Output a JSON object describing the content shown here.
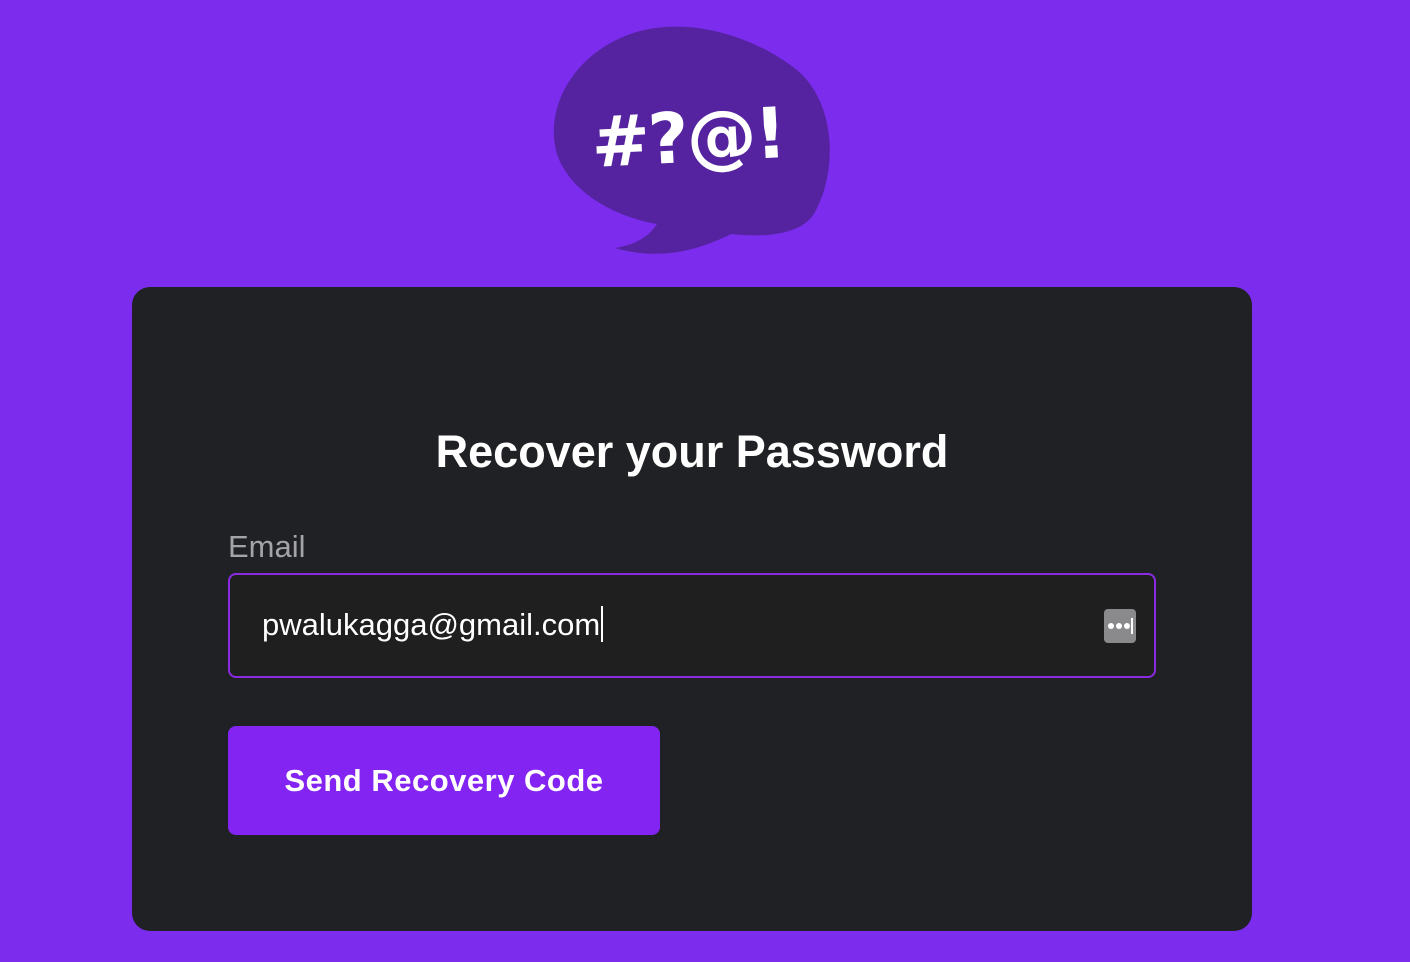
{
  "logo": {
    "text": "#?@!",
    "bubble_color": "#5523a0"
  },
  "colors": {
    "background": "#7b2cec",
    "card": "#202124",
    "accent": "#8424f2"
  },
  "form": {
    "title": "Recover your Password",
    "email_label": "Email",
    "email_value": "pwalukagga@gmail.com",
    "password_manager_icon": "password-key-icon",
    "submit_label": "Send Recovery Code"
  }
}
